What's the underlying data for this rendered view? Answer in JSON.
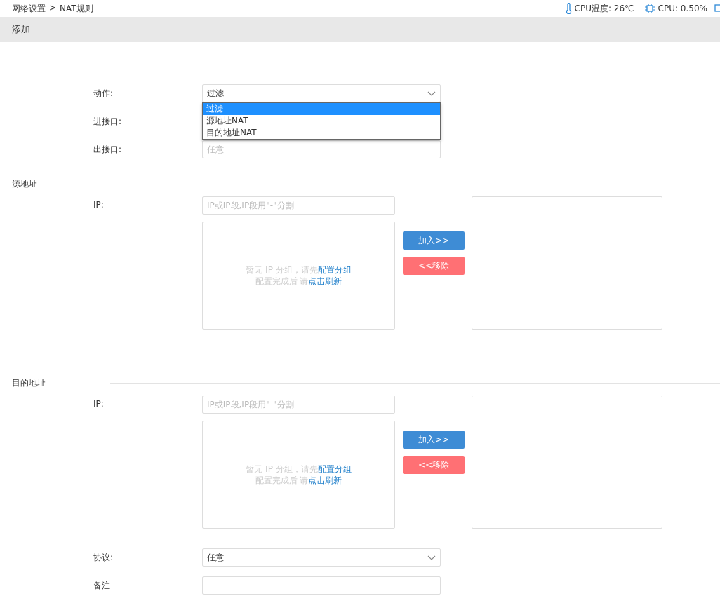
{
  "breadcrumb": {
    "parent": "网络设置",
    "separator": ">",
    "current": "NAT规则"
  },
  "status": [
    {
      "kind": "temp",
      "text": "CPU温度: 26℃"
    },
    {
      "kind": "cpu",
      "text": "CPU: 0.50%"
    }
  ],
  "header": {
    "title": "添加"
  },
  "action": {
    "label": "动作:",
    "value": "过滤",
    "options": [
      {
        "label": "过滤",
        "selected": true
      },
      {
        "label": "源地址NAT",
        "selected": false
      },
      {
        "label": "目的地址NAT",
        "selected": false
      }
    ]
  },
  "in_interface": {
    "label": "进接口:"
  },
  "out_interface": {
    "label": "出接口:",
    "placeholder": "任意"
  },
  "sections": [
    {
      "title": "源地址",
      "ip_label": "IP:",
      "ip_placeholder": "IP或IP段,IP段用\"-\"分割",
      "empty_line1": "暂无 IP 分组，请先",
      "empty_link1": "配置分组",
      "empty_line2": "配置完成后 请",
      "empty_link2": "点击刷新",
      "add_button": "加入>>",
      "remove_button": "<<移除"
    },
    {
      "title": "目的地址",
      "ip_label": "IP:",
      "ip_placeholder": "IP或IP段,IP段用\"-\"分割",
      "empty_line1": "暂无 IP 分组，请先",
      "empty_link1": "配置分组",
      "empty_line2": "配置完成后 请",
      "empty_link2": "点击刷新",
      "add_button": "加入>>",
      "remove_button": "<<移除"
    }
  ],
  "protocol": {
    "label": "协议:",
    "value": "任意"
  },
  "note": {
    "label": "备注"
  }
}
